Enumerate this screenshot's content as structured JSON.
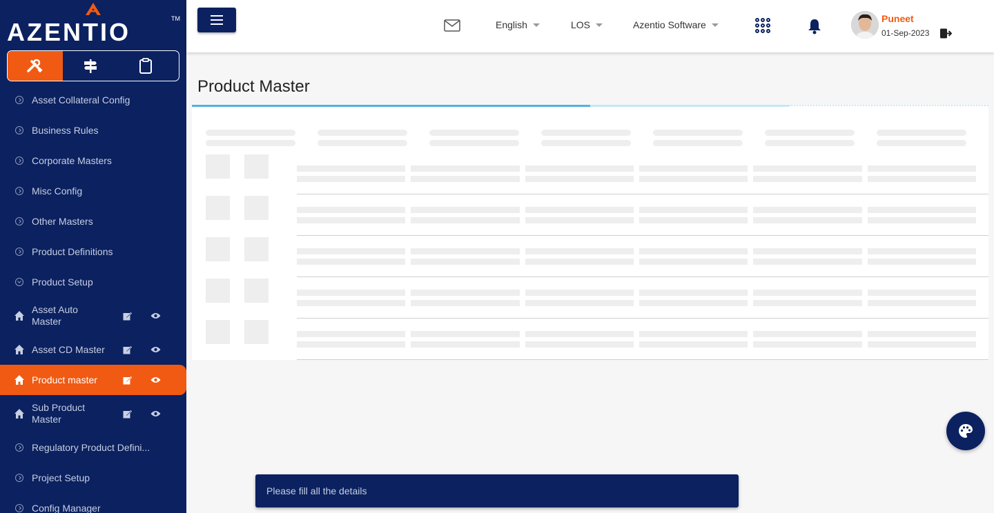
{
  "brand": {
    "name": "AZENTIO",
    "tm": "TM"
  },
  "sidebar": {
    "switcher": [
      {
        "icon": "tools-icon",
        "active": true
      },
      {
        "icon": "signpost-icon",
        "active": false
      },
      {
        "icon": "clipboard-icon",
        "active": false
      }
    ],
    "items": [
      {
        "label": "Asset Collateral Config"
      },
      {
        "label": "Business Rules"
      },
      {
        "label": "Corporate Masters"
      },
      {
        "label": "Misc Config"
      },
      {
        "label": "Other Masters"
      },
      {
        "label": "Product Definitions"
      },
      {
        "label": "Product Setup"
      },
      {
        "label": "Asset Auto Master"
      },
      {
        "label": "Asset CD Master"
      },
      {
        "label": "Product master"
      },
      {
        "label": "Sub Product Master"
      },
      {
        "label": "Regulatory Product Defini..."
      },
      {
        "label": "Project Setup"
      },
      {
        "label": "Config Manager"
      }
    ]
  },
  "topbar": {
    "language": "English",
    "module": "LOS",
    "company": "Azentio Software",
    "user": {
      "name": "Puneet",
      "date": "01-Sep-2023"
    }
  },
  "main": {
    "title": "Product Master"
  },
  "toast": {
    "message": "Please fill all the details"
  },
  "colors": {
    "navy": "#0b2160",
    "accent": "#f15a13",
    "progress": "#4fb1e6"
  }
}
